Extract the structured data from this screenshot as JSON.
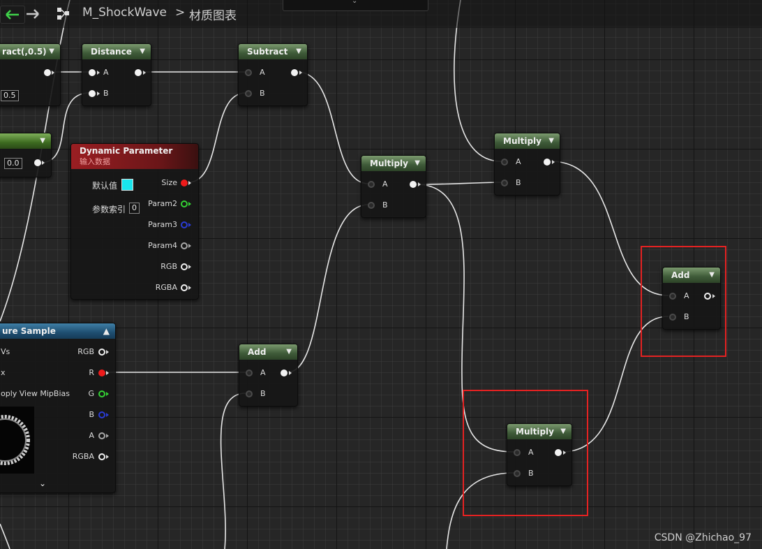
{
  "breadcrumb": {
    "asset": "M_ShockWave",
    "separator": ">",
    "graph": "材质图表"
  },
  "nodes": {
    "subtract_left": {
      "title": "ract(,0.5)",
      "value": "0.5"
    },
    "constant_left": {
      "value": "0.0"
    },
    "distance": {
      "title": "Distance",
      "pin_a": "A",
      "pin_b": "B"
    },
    "subtract": {
      "title": "Subtract",
      "pin_a": "A",
      "pin_b": "B"
    },
    "dynamic_param": {
      "title": "Dynamic Parameter",
      "subtitle": "输入数据",
      "default_label": "默认值",
      "default_color": "#19e6ee",
      "index_label": "参数索引",
      "index_value": "0",
      "outputs": [
        "Size",
        "Param2",
        "Param3",
        "Param4",
        "RGB",
        "RGBA"
      ]
    },
    "multiply_center": {
      "title": "Multiply",
      "pin_a": "A",
      "pin_b": "B"
    },
    "multiply_top": {
      "title": "Multiply",
      "pin_a": "A",
      "pin_b": "B"
    },
    "add_right": {
      "title": "Add",
      "pin_a": "A",
      "pin_b": "B"
    },
    "texture_sample": {
      "title": "ure Sample",
      "inputs": [
        "Vs",
        "x",
        "oply View MipBias"
      ],
      "outputs": [
        "RGB",
        "R",
        "G",
        "B",
        "A",
        "RGBA"
      ]
    },
    "add_bottom": {
      "title": "Add",
      "pin_a": "A",
      "pin_b": "B"
    },
    "multiply_bottom": {
      "title": "Multiply",
      "pin_a": "A",
      "pin_b": "B"
    }
  },
  "watermark": "CSDN @Zhichao_97",
  "colors": {
    "selection": "#e52222",
    "header_green": "#3e5a38",
    "header_red": "#6a1618",
    "header_blue": "#1e4e70",
    "pin_red": "#ee1b1b",
    "pin_green": "#34d234",
    "pin_blue": "#2a3cd6"
  }
}
